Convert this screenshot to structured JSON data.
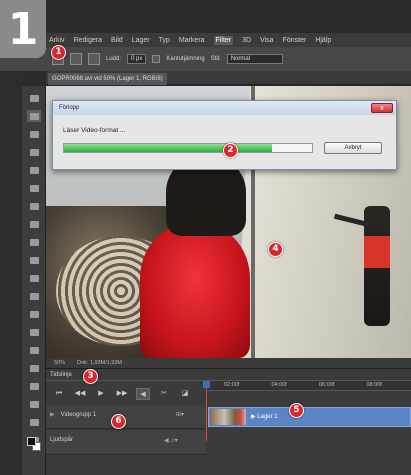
{
  "step_number": "1",
  "menubar": {
    "items": [
      "Arkiv",
      "Redigera",
      "Bild",
      "Lager",
      "Typ",
      "Markera",
      "Filter",
      "3D",
      "Visa",
      "Fönster",
      "Hjälp"
    ],
    "active_index": 6
  },
  "options_bar": {
    "feather_label": "Ludd:",
    "feather_value": "0 px",
    "antialias_label": "Kantutjämning",
    "style_label": "Stil:",
    "style_value": "Normal"
  },
  "document_tab": "GOPR0068.avi vid 50% (Lager 1, RGB/8)",
  "dialog": {
    "title": "Förlopp",
    "close_glyph": "x",
    "message": "Läser Video-format ...",
    "progress": 0.84,
    "cancel_label": "Avbryt"
  },
  "statusbar": {
    "zoom": "50%",
    "doc_size": "Dok: 1,93M/1,93M"
  },
  "timeline": {
    "title": "Tidslinje",
    "ruler_ticks": [
      "02:00f",
      "04:00f",
      "06:00f",
      "08:00f"
    ],
    "tracks": [
      {
        "name": "Videogrupp 1",
        "clip_label": "Lager 1"
      },
      {
        "name": "Ljudspår"
      }
    ]
  },
  "callouts": [
    "1",
    "2",
    "3",
    "4",
    "5",
    "6"
  ],
  "colors": {
    "accent_marker": "#d8282e",
    "progress_green": "#2fae3f",
    "clip_blue": "#5b84c7",
    "playhead": "#d04a3a"
  }
}
